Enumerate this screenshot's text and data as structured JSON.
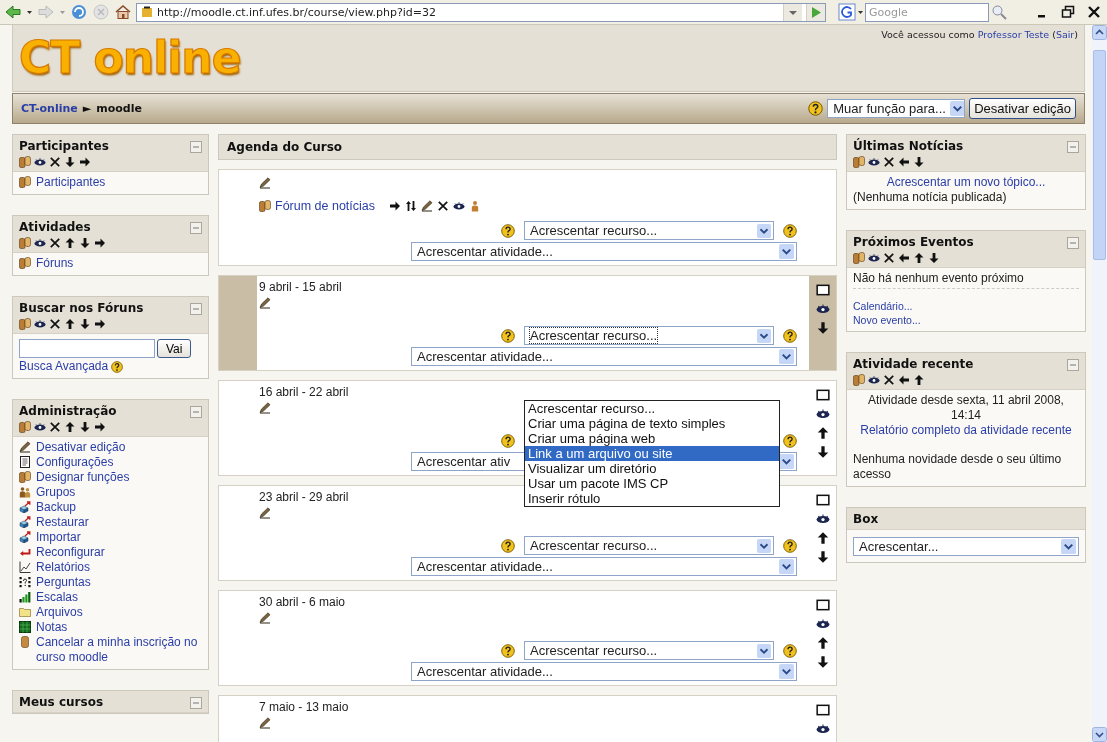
{
  "browser": {
    "url": "http://moodle.ct.inf.ufes.br/course/view.php?id=32",
    "search": {
      "placeholder": "Google"
    }
  },
  "header": {
    "logo": "CT online",
    "login": [
      {
        "text": "Você acessou como "
      },
      {
        "link": "Professor Teste"
      },
      {
        "text": " ("
      },
      {
        "link": "Sair"
      },
      {
        "text": ")"
      }
    ]
  },
  "breadcrumb": {
    "separator": "►",
    "items": [
      {
        "label": "CT-online",
        "link": true
      },
      {
        "label": "moodle",
        "link": false
      }
    ]
  },
  "role_select": {
    "value": "Muar função para..."
  },
  "edit_button": "Desativar edição",
  "left_blocks": [
    {
      "kind": "list",
      "title": "Participantes",
      "collapsible": true,
      "controls": [
        {
          "kind": "roles"
        },
        {
          "kind": "hide"
        },
        {
          "kind": "delete"
        },
        {
          "kind": "down"
        },
        {
          "kind": "right"
        }
      ],
      "items": [
        {
          "kind": "roles",
          "label": "Participantes"
        }
      ]
    },
    {
      "kind": "list",
      "title": "Atividades",
      "collapsible": true,
      "controls": [
        {
          "kind": "roles"
        },
        {
          "kind": "hide"
        },
        {
          "kind": "delete"
        },
        {
          "kind": "up"
        },
        {
          "kind": "down"
        },
        {
          "kind": "right"
        }
      ],
      "items": [
        {
          "kind": "roles",
          "label": "Fóruns"
        }
      ]
    },
    {
      "kind": "search",
      "title": "Buscar nos Fóruns",
      "collapsible": true,
      "controls": [
        {
          "kind": "roles"
        },
        {
          "kind": "hide"
        },
        {
          "kind": "delete"
        },
        {
          "kind": "up"
        },
        {
          "kind": "down"
        },
        {
          "kind": "right"
        }
      ],
      "button": "Vai",
      "link": "Busca Avançada"
    },
    {
      "kind": "list",
      "title": "Administração",
      "collapsible": true,
      "controls": [
        {
          "kind": "roles"
        },
        {
          "kind": "hide"
        },
        {
          "kind": "delete"
        },
        {
          "kind": "up"
        },
        {
          "kind": "down"
        },
        {
          "kind": "right"
        }
      ],
      "items": [
        {
          "kind": "edit",
          "label": "Desativar edição"
        },
        {
          "kind": "document",
          "label": "Configurações"
        },
        {
          "kind": "roles",
          "label": "Designar funções"
        },
        {
          "kind": "group",
          "label": "Grupos"
        },
        {
          "kind": "backup",
          "label": "Backup"
        },
        {
          "kind": "restore",
          "label": "Restaurar"
        },
        {
          "kind": "import",
          "label": "Importar"
        },
        {
          "kind": "reset",
          "label": "Reconfigurar"
        },
        {
          "kind": "chart",
          "label": "Relatórios"
        },
        {
          "kind": "questions",
          "label": "Perguntas"
        },
        {
          "kind": "scales",
          "label": "Escalas"
        },
        {
          "kind": "folder",
          "label": "Arquivos"
        },
        {
          "kind": "grades",
          "label": "Notas"
        },
        {
          "kind": "unenrol",
          "label": "Cancelar a minha inscrição no curso moodle"
        }
      ]
    },
    {
      "kind": "list",
      "title": "Meus cursos",
      "collapsible": true
    }
  ],
  "course": {
    "title": "Agenda do Curso",
    "sections": [
      {
        "current": false,
        "activities": [
          {
            "kind": "roles",
            "label": "Fórum de notícias",
            "controls": [
              {
                "kind": "right"
              },
              {
                "kind": "move"
              },
              {
                "kind": "edit"
              },
              {
                "kind": "delete"
              },
              {
                "kind": "hide"
              },
              {
                "kind": "assign"
              }
            ]
          }
        ],
        "resource": {
          "value": "Acrescentar recurso...",
          "focused": false
        },
        "activity": "Acrescentar atividade..."
      },
      {
        "title": "9 abril - 15 abril",
        "current": true,
        "controls": [
          {
            "kind": "highlight"
          },
          {
            "kind": "hide"
          },
          {
            "kind": "down"
          }
        ],
        "resource": {
          "value": "Acrescentar recurso...",
          "focused": true
        },
        "activity": "Acrescentar atividade..."
      },
      {
        "title": "16 abril - 22 abril",
        "current": false,
        "controls": [
          {
            "kind": "highlight"
          },
          {
            "kind": "hide"
          },
          {
            "kind": "up"
          },
          {
            "kind": "down"
          }
        ],
        "resource": {
          "open": true,
          "options": [
            {
              "label": "Acrescentar recurso...",
              "selected": false
            },
            {
              "label": "Criar uma página de texto simples",
              "selected": false
            },
            {
              "label": "Criar uma página web",
              "selected": false
            },
            {
              "label": "Link a um arquivo ou site",
              "selected": true
            },
            {
              "label": "Visualizar um diretório",
              "selected": false
            },
            {
              "label": "Usar um pacote IMS CP",
              "selected": false
            },
            {
              "label": "Inserir rótulo",
              "selected": false
            }
          ]
        },
        "activity": "Acrescentar ativ"
      },
      {
        "title": "23 abril - 29 abril",
        "current": false,
        "controls": [
          {
            "kind": "highlight"
          },
          {
            "kind": "hide"
          },
          {
            "kind": "up"
          },
          {
            "kind": "down"
          }
        ],
        "resource": {
          "value": "Acrescentar recurso...",
          "focused": false
        },
        "activity": "Acrescentar atividade..."
      },
      {
        "title": "30 abril - 6 maio",
        "current": false,
        "controls": [
          {
            "kind": "highlight"
          },
          {
            "kind": "hide"
          },
          {
            "kind": "up"
          },
          {
            "kind": "down"
          }
        ],
        "resource": {
          "value": "Acrescentar recurso...",
          "focused": false
        },
        "activity": "Acrescentar atividade..."
      },
      {
        "title": "7 maio - 13 maio",
        "current": false,
        "controls": [
          {
            "kind": "highlight"
          },
          {
            "kind": "hide"
          }
        ]
      }
    ]
  },
  "right_blocks": [
    {
      "kind": "news",
      "title": "Últimas Notícias",
      "collapsible": true,
      "controls": [
        {
          "kind": "roles"
        },
        {
          "kind": "hide"
        },
        {
          "kind": "delete"
        },
        {
          "kind": "left"
        },
        {
          "kind": "down"
        }
      ],
      "link": "Acrescentar um novo tópico...",
      "text": "(Nenhuma notícia publicada)"
    },
    {
      "kind": "events",
      "title": "Próximos Eventos",
      "collapsible": true,
      "controls": [
        {
          "kind": "roles"
        },
        {
          "kind": "hide"
        },
        {
          "kind": "delete"
        },
        {
          "kind": "left"
        },
        {
          "kind": "up"
        },
        {
          "kind": "down"
        }
      ],
      "text": "Não há nenhum evento próximo",
      "links": [
        "Calendário...",
        "Novo evento..."
      ]
    },
    {
      "kind": "recent",
      "title": "Atividade recente",
      "collapsible": true,
      "controls": [
        {
          "kind": "roles"
        },
        {
          "kind": "hide"
        },
        {
          "kind": "delete"
        },
        {
          "kind": "left"
        },
        {
          "kind": "up"
        }
      ],
      "since": "Atividade desde sexta, 11 abril 2008, 14:14",
      "link": "Relatório completo da atividade recente",
      "text": "Nenhuma novidade desde o seu último acesso"
    },
    {
      "kind": "select",
      "title": "Box",
      "collapsible": false,
      "value": "Acrescentar..."
    }
  ]
}
